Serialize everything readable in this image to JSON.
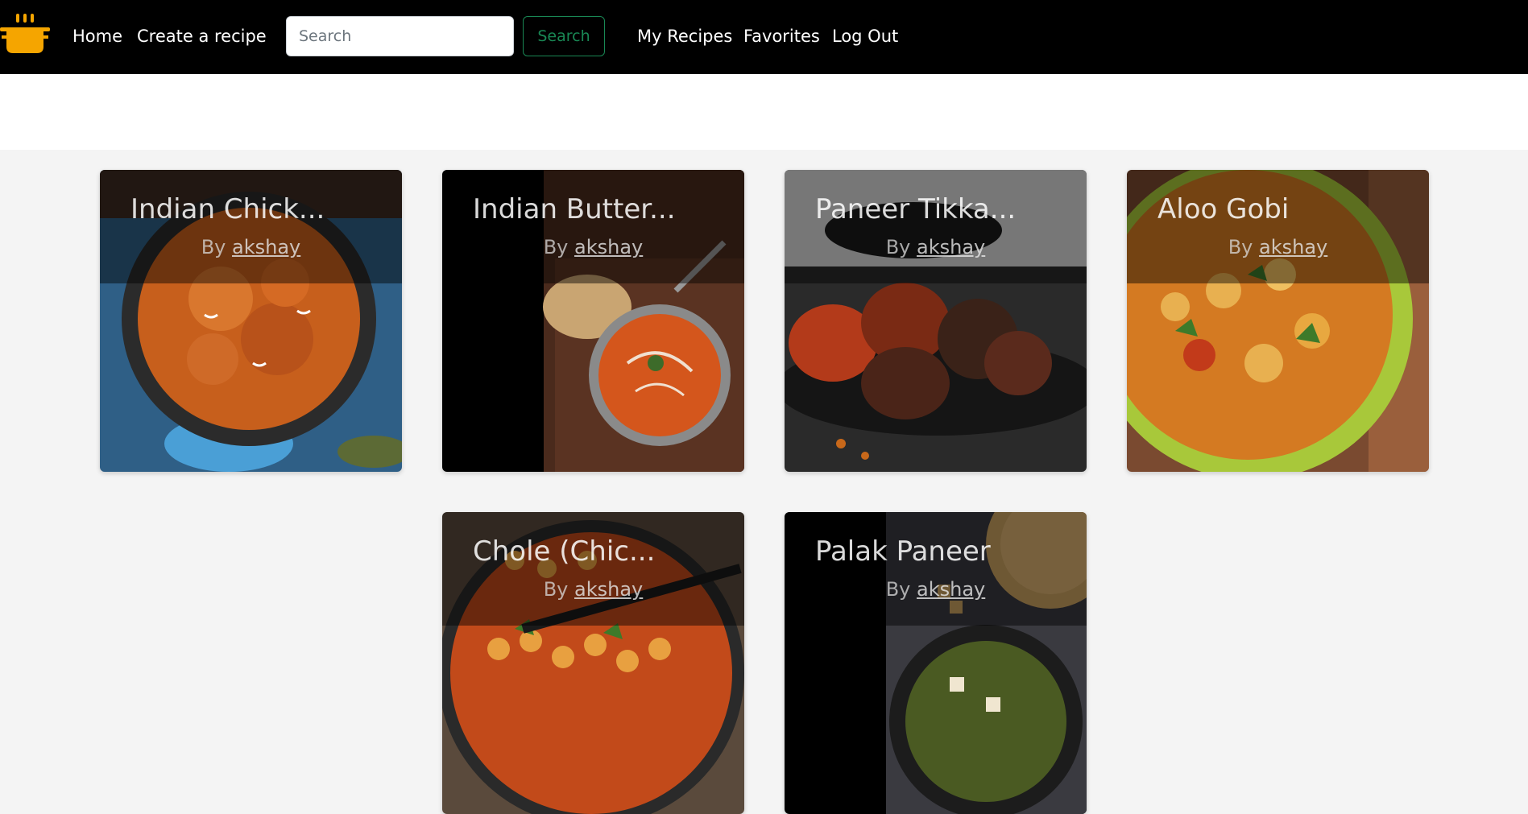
{
  "nav": {
    "logo_icon": "cooking-pot-icon",
    "logo_color": "#f5a500",
    "home": "Home",
    "create": "Create a recipe",
    "search_placeholder": "Search",
    "search_button": "Search",
    "my_recipes": "My Recipes",
    "favorites": "Favorites",
    "logout": "Log Out"
  },
  "recipes": [
    {
      "title": "Indian Chick...",
      "by": "By",
      "author": "akshay",
      "image": "butter-chicken-skillet-image"
    },
    {
      "title": "Indian Butter...",
      "by": "By",
      "author": "akshay",
      "image": "butter-chicken-bowl-image"
    },
    {
      "title": "Paneer Tikka...",
      "by": "By",
      "author": "akshay",
      "image": "paneer-tikka-image"
    },
    {
      "title": "Aloo Gobi",
      "by": "By",
      "author": "akshay",
      "image": "aloo-gobi-image"
    },
    {
      "title": "Chole (Chic...",
      "by": "By",
      "author": "akshay",
      "image": "chole-image"
    },
    {
      "title": "Palak Paneer",
      "by": "By",
      "author": "akshay",
      "image": "palak-paneer-image"
    }
  ]
}
